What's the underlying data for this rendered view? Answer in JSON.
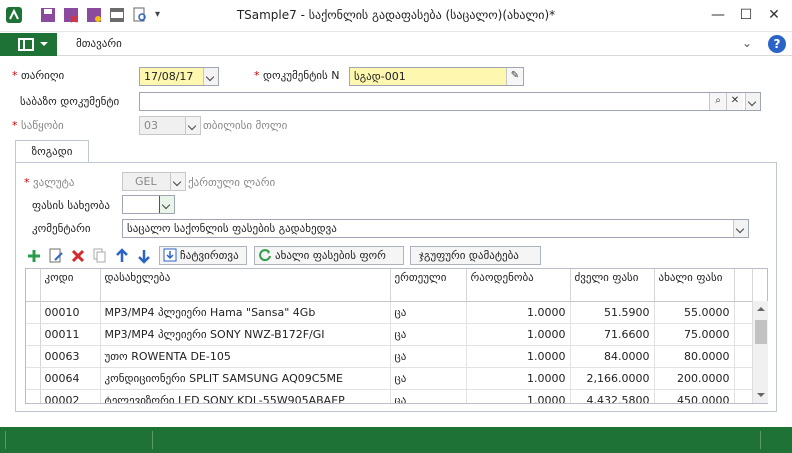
{
  "window": {
    "title": "TSample7 - საქონლის გადაფასება (საცალო)(ახალი)*"
  },
  "ribbon": {
    "main_tab": "მთავარი"
  },
  "form": {
    "date_label": "თარიღი",
    "date_value": "17/08/17",
    "docnum_label": "დოკუმენტის N",
    "docnum_value": "სგად-001",
    "base_doc_label": "საბაზო დოკუმენტი",
    "base_doc_value": "",
    "warehouse_label": "საწყობი",
    "warehouse_code": "03",
    "warehouse_name": "თბილისი მოლი"
  },
  "tab": {
    "label": "ზოგადი",
    "currency_label": "ვალუტა",
    "currency_code": "GEL",
    "currency_name": "ქართული ლარი",
    "pricetype_label": "ფასის სახეობა",
    "pricetype_value": "",
    "comment_label": "კომენტარი",
    "comment_value": "საცალო საქონლის ფასების გადახედვა"
  },
  "toolbar": {
    "btn_include": "ჩატვირთვა",
    "btn_newprice": "ახალი ფასების ფორ",
    "btn_groupadd": "ჯგუფური დამატება"
  },
  "grid": {
    "columns": [
      "კოდი",
      "დასახელება",
      "ერთეული",
      "რაოდენობა",
      "ძველი ფასი",
      "ახალი ფასი"
    ],
    "rows": [
      {
        "code": "00010",
        "name": "MP3/MP4 პლეიერი Hama \"Sansa\" 4Gb",
        "unit": "ცა",
        "qty": "1.0000",
        "old": "51.5900",
        "new": "55.0000"
      },
      {
        "code": "00011",
        "name": "MP3/MP4 პლეიერი SONY NWZ-B172F/GI",
        "unit": "ცა",
        "qty": "1.0000",
        "old": "71.6600",
        "new": "75.0000"
      },
      {
        "code": "00063",
        "name": "უთო ROWENTA DE-105",
        "unit": "ცა",
        "qty": "1.0000",
        "old": "84.0000",
        "new": "80.0000"
      },
      {
        "code": "00064",
        "name": "კონდიციონერი SPLIT SAMSUNG AQ09C5ME",
        "unit": "ცა",
        "qty": "1.0000",
        "old": "2,166.0000",
        "new": "200.0000"
      },
      {
        "code": "00002",
        "name": "ტელევიზორი LED SONY KDL-55W905ABAEP",
        "unit": "ცა",
        "qty": "1.0000",
        "old": "4,432.5800",
        "new": "450.0000"
      }
    ]
  },
  "colors": {
    "accent": "#1e7236",
    "required": "#cc0000",
    "highlight": "#fdf7b0"
  }
}
